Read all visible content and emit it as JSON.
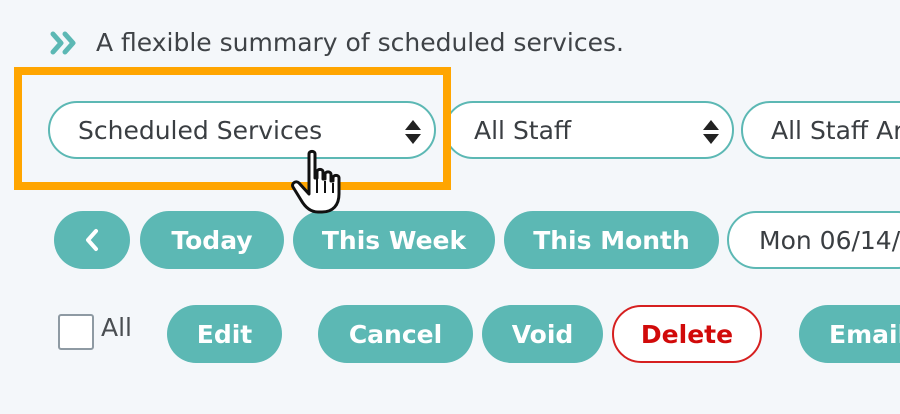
{
  "intro": {
    "icon": "double-chevron-right-icon",
    "icon_color": "#5cb8b4",
    "text": "A flexible summary of scheduled services."
  },
  "filters": {
    "report_type": "Scheduled Services",
    "staff": "All Staff",
    "staff_area": "All Staff Ar"
  },
  "date_nav": {
    "prev_icon": "chevron-left-icon",
    "today": "Today",
    "this_week": "This Week",
    "this_month": "This Month",
    "date_value": "Mon 06/14/"
  },
  "actions": {
    "select_all_label": "All",
    "edit": "Edit",
    "cancel": "Cancel",
    "void": "Void",
    "delete": "Delete",
    "email": "Email"
  },
  "colors": {
    "accent": "#5cb8b4",
    "highlight": "#ffa500",
    "danger": "#d10a0a"
  }
}
